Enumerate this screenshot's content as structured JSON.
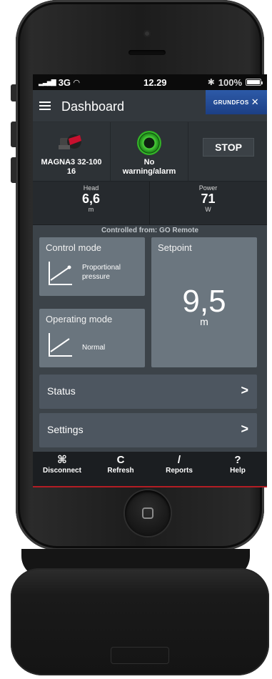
{
  "status_bar": {
    "carrier": "3G",
    "time": "12.29",
    "battery": "100%"
  },
  "header": {
    "title": "Dashboard",
    "brand": "GRUNDFOS"
  },
  "pump": {
    "name_line1": "MAGNA3 32-100",
    "name_line2": "16"
  },
  "alarm": {
    "line1": "No",
    "line2": "warning/alarm"
  },
  "stop_label": "STOP",
  "metrics": {
    "head": {
      "label": "Head",
      "value": "6,6",
      "unit": "m"
    },
    "power": {
      "label": "Power",
      "value": "71",
      "unit": "W"
    }
  },
  "controlled_from": "Controlled from: GO Remote",
  "control_mode": {
    "title": "Control mode",
    "line1": "Proportional",
    "line2": "pressure"
  },
  "operating_mode": {
    "title": "Operating mode",
    "value": "Normal"
  },
  "setpoint": {
    "title": "Setpoint",
    "value": "9,5",
    "unit": "m"
  },
  "nav": {
    "status": "Status",
    "settings": "Settings"
  },
  "tabs": {
    "disconnect": "Disconnect",
    "refresh": "Refresh",
    "reports": "Reports",
    "help": "Help"
  },
  "colors": {
    "accent_red": "#b31d24",
    "brand_blue": "#1c3f86",
    "status_green": "#39c02c"
  }
}
